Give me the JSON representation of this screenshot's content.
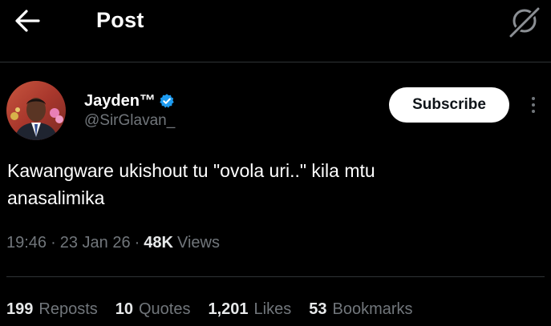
{
  "header": {
    "title": "Post",
    "back_icon": "arrow-left-icon",
    "grok_icon": "grok-icon"
  },
  "author": {
    "display_name": "Jayden™",
    "handle": "@SirGlavan_",
    "verified_icon": "verified-badge-icon",
    "avatar_icon": "profile-photo"
  },
  "actions": {
    "subscribe_label": "Subscribe",
    "more_icon": "more-vertical-icon"
  },
  "post": {
    "text": "Kawangware ukishout tu \"ovola uri..\" kila mtu\nanasalimika"
  },
  "meta": {
    "time": "19:46",
    "separator": "·",
    "date": "23 Jan 26",
    "views_count": "48K",
    "views_label": "Views"
  },
  "stats": [
    {
      "count": "199",
      "label": "Reposts"
    },
    {
      "count": "10",
      "label": "Quotes"
    },
    {
      "count": "1,201",
      "label": "Likes"
    },
    {
      "count": "53",
      "label": "Bookmarks"
    }
  ],
  "colors": {
    "background": "#000000",
    "primary_text": "#e7e9ea",
    "secondary_text": "#71767b",
    "divider": "#2f3336",
    "verified_blue": "#1d9bf0",
    "button_bg": "#ffffff"
  }
}
